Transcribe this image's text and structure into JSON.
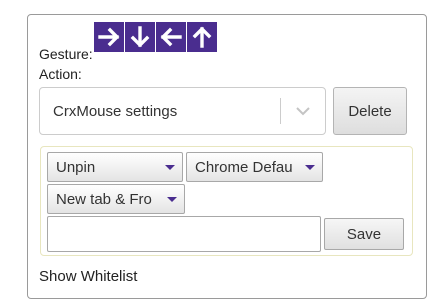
{
  "gesture": {
    "label": "Gesture:",
    "arrows": [
      {
        "direction": "right",
        "icon": "arrow-right-icon"
      },
      {
        "direction": "down",
        "icon": "arrow-down-icon"
      },
      {
        "direction": "left",
        "icon": "arrow-left-icon"
      },
      {
        "direction": "up",
        "icon": "arrow-up-icon"
      }
    ],
    "arrow_bg_color": "#4a2d8f"
  },
  "action": {
    "label": "Action:",
    "selected": "CrxMouse settings",
    "delete_label": "Delete"
  },
  "options": {
    "pin_select": "Unpin",
    "browser_select": "Chrome Defau",
    "tab_select": "New tab & Fro",
    "input_value": "",
    "save_label": "Save",
    "caret_color": "#4a2d8f"
  },
  "footer": {
    "whitelist_link": "Show Whitelist"
  }
}
